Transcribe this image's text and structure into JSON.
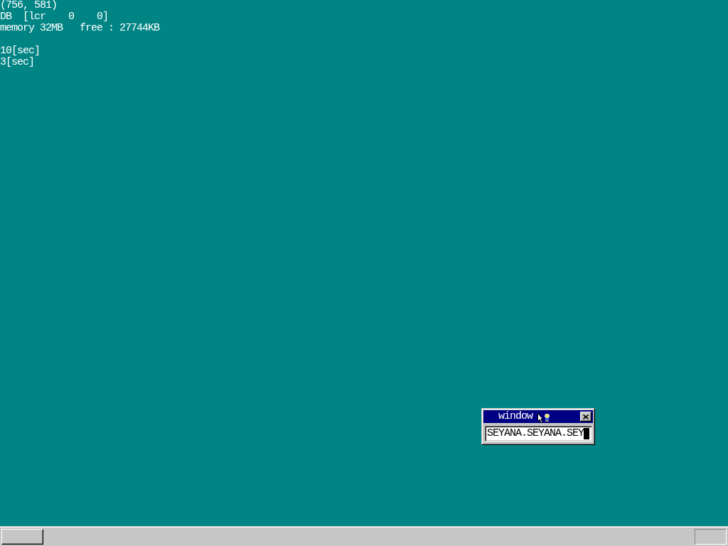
{
  "debug_text": {
    "status_lines": [
      "(756, 581)",
      "DB  [lcr    0    0]",
      "memory 32MB   free : 27744KB"
    ],
    "timer_lines": [
      "10[sec]",
      "3[sec]"
    ]
  },
  "window": {
    "title": "window",
    "active": true,
    "textbox": {
      "value": "SEYANA.SEYANA.SEY",
      "cursor_on": true
    }
  }
}
